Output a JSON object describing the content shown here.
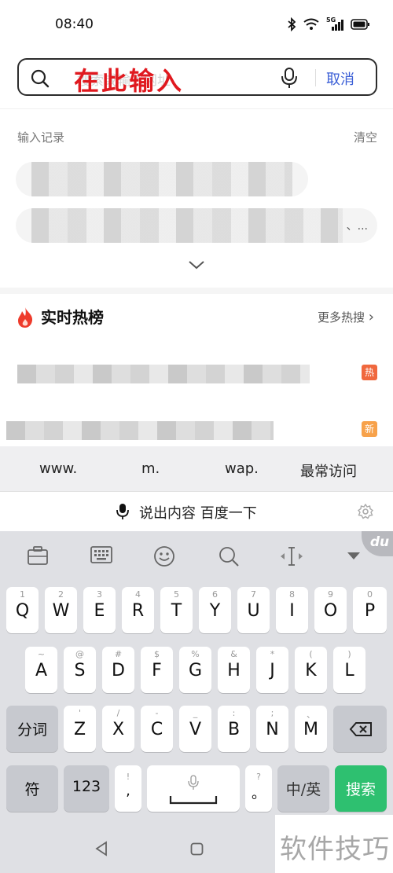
{
  "status_bar": {
    "time": "08:40",
    "network_label": "5G"
  },
  "search": {
    "placeholder": "搜索或输入网址",
    "handwritten_annotation": "在此输入",
    "cancel_label": "取消"
  },
  "history": {
    "title": "输入记录",
    "clear_label": "清空",
    "overflow_text": "、..."
  },
  "hot": {
    "title": "实时热榜",
    "more_label": "更多热搜",
    "items": [
      {
        "badge": "热",
        "badge_color": "#f0683e"
      },
      {
        "badge": "新",
        "badge_color": "#f7a24b"
      }
    ]
  },
  "suggestions": [
    "www.",
    "m.",
    "wap.",
    "最常访问"
  ],
  "voice": {
    "label": "说出内容 百度一下"
  },
  "keyboard": {
    "du_label": "du",
    "row1": [
      {
        "hint": "1",
        "key": "Q"
      },
      {
        "hint": "2",
        "key": "W"
      },
      {
        "hint": "3",
        "key": "E"
      },
      {
        "hint": "4",
        "key": "R"
      },
      {
        "hint": "5",
        "key": "T"
      },
      {
        "hint": "6",
        "key": "Y"
      },
      {
        "hint": "7",
        "key": "U"
      },
      {
        "hint": "8",
        "key": "I"
      },
      {
        "hint": "9",
        "key": "O"
      },
      {
        "hint": "0",
        "key": "P"
      }
    ],
    "row2": [
      {
        "hint": "~",
        "key": "A"
      },
      {
        "hint": "@",
        "key": "S"
      },
      {
        "hint": "#",
        "key": "D"
      },
      {
        "hint": "$",
        "key": "F"
      },
      {
        "hint": "%",
        "key": "G"
      },
      {
        "hint": "&",
        "key": "H"
      },
      {
        "hint": "*",
        "key": "J"
      },
      {
        "hint": "(",
        "key": "K"
      },
      {
        "hint": ")",
        "key": "L"
      }
    ],
    "row3": [
      {
        "hint": "'",
        "key": "Z"
      },
      {
        "hint": "/",
        "key": "X"
      },
      {
        "hint": "-",
        "key": "C"
      },
      {
        "hint": "_",
        "key": "V"
      },
      {
        "hint": ":",
        "key": "B"
      },
      {
        "hint": ";",
        "key": "N"
      },
      {
        "hint": "、",
        "key": "M"
      }
    ],
    "fenci_label": "分词",
    "symbol_label": "符",
    "num_label": "123",
    "comma_hint": "!",
    "comma_key": ",",
    "period_hint": "?",
    "period_key": "。",
    "lang_label": "中/英",
    "search_label": "搜索",
    "accent_color": "#2ec070"
  },
  "watermark": "软件技巧"
}
